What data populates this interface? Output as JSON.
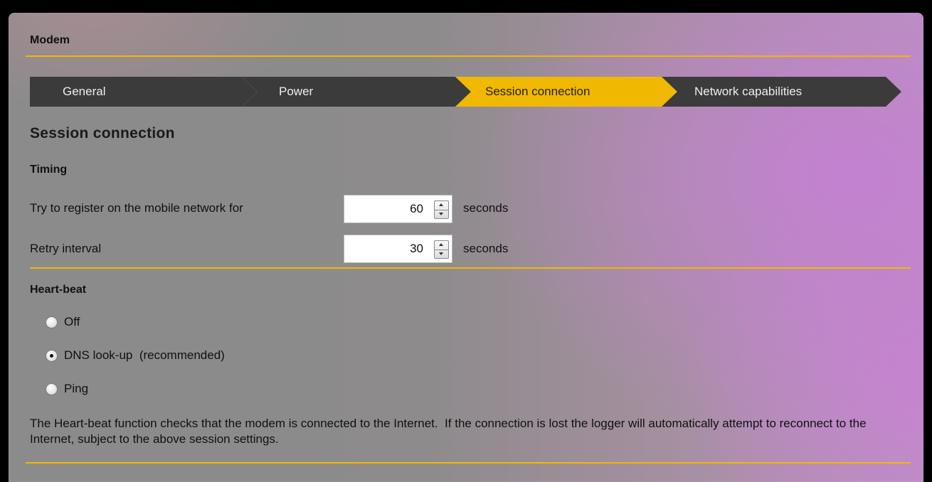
{
  "panel": {
    "title": "Modem"
  },
  "steps": [
    {
      "label": "General",
      "active": false
    },
    {
      "label": "Power",
      "active": false
    },
    {
      "label": "Session connection",
      "active": true
    },
    {
      "label": "Network capabilities",
      "active": false
    }
  ],
  "section": {
    "title": "Session connection",
    "timing": {
      "heading": "Timing",
      "register": {
        "label": "Try to register on the mobile network for",
        "value": "60",
        "unit": "seconds"
      },
      "retry": {
        "label": "Retry interval",
        "value": "30",
        "unit": "seconds"
      }
    },
    "heartbeat": {
      "heading": "Heart-beat",
      "options": [
        {
          "label": "Off",
          "checked": false
        },
        {
          "label": "DNS look-up  (recommended)",
          "checked": true
        },
        {
          "label": "Ping",
          "checked": false
        }
      ],
      "description": "The Heart-beat function checks that the modem is connected to the Internet.  If the connection is lost the logger will automatically attempt to reconnect to the Internet, subject to the above session settings."
    }
  },
  "colors": {
    "accent": "#f0b800",
    "step_dark": "#3a3a3a",
    "step_active": "#f0b800"
  }
}
